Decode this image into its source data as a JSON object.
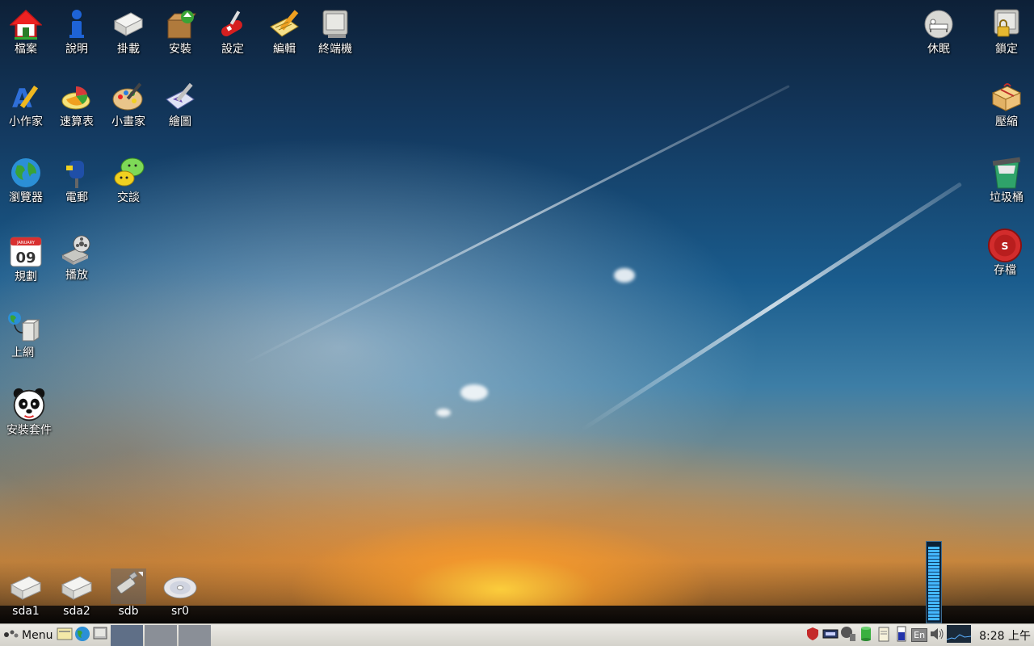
{
  "desktop_icons": {
    "files": "檔案",
    "help": "說明",
    "mount": "掛載",
    "install": "安裝",
    "settings": "設定",
    "edit": "編輯",
    "terminal": "終端機",
    "writer": "小作家",
    "spreadsheet": "速算表",
    "paint": "小畫家",
    "draw": "繪圖",
    "browser": "瀏覽器",
    "email": "電郵",
    "chat": "交談",
    "planner": "規劃",
    "play": "播放",
    "connect": "上網",
    "package_manager": "安裝套件",
    "sleep": "休眠",
    "lock": "鎖定",
    "zip": "壓縮",
    "trash": "垃圾桶",
    "save": "存檔"
  },
  "calendar_day": "09",
  "calendar_month": "JANUARY",
  "save_badge": "S",
  "drives": [
    "sda1",
    "sda2",
    "sdb",
    "sr0"
  ],
  "taskbar": {
    "menu_label": "Menu",
    "workspaces": 3,
    "active_workspace": 1,
    "language": "En",
    "clock": "8:28 上午"
  },
  "volume_level": 0.96,
  "colors": {
    "accent_red": "#d22c2c",
    "taskbar_bg": "#e3e1da",
    "meter_fill": "#44b8ff"
  }
}
